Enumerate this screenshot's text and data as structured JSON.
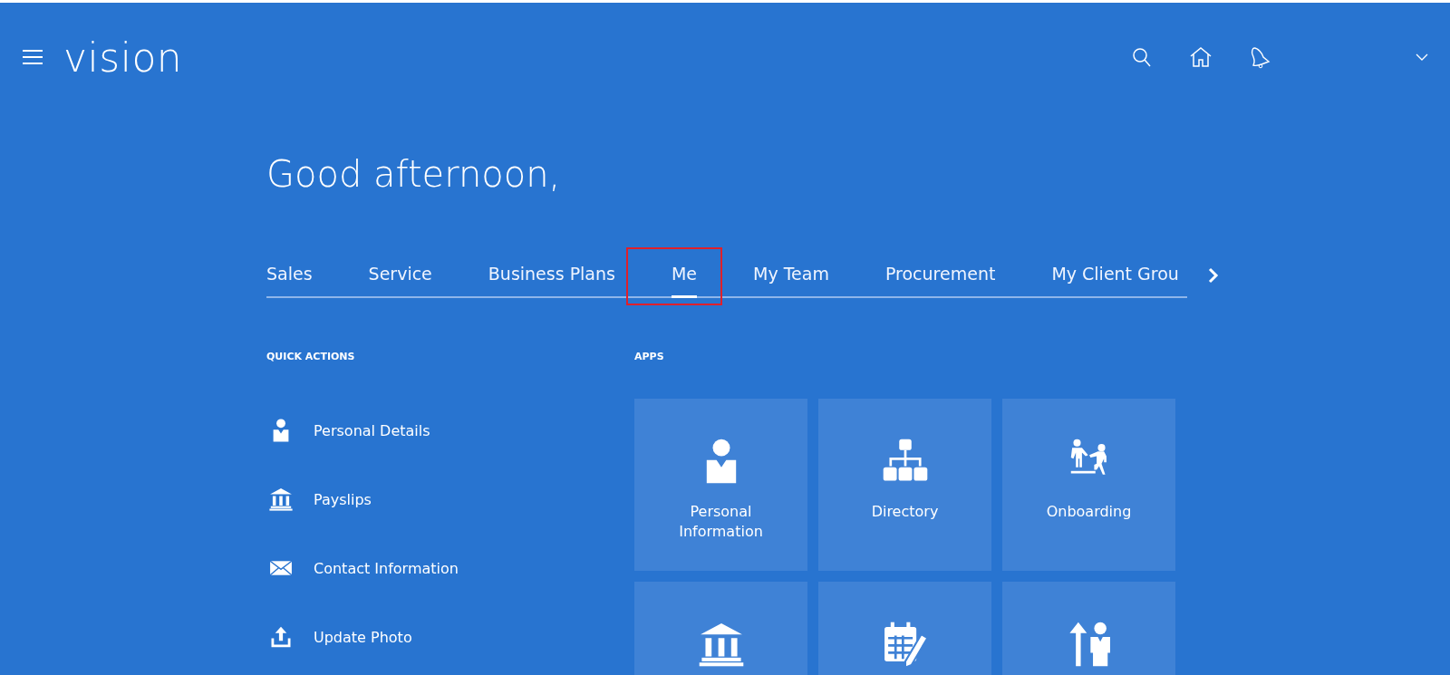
{
  "header": {
    "logo": "vision"
  },
  "greeting": "Good afternoon,",
  "tabs": [
    {
      "label": "Sales",
      "selected": false,
      "highlighted": false
    },
    {
      "label": "Service",
      "selected": false,
      "highlighted": false
    },
    {
      "label": "Business Plans",
      "selected": false,
      "highlighted": false
    },
    {
      "label": "Me",
      "selected": true,
      "highlighted": true
    },
    {
      "label": "My Team",
      "selected": false,
      "highlighted": false
    },
    {
      "label": "Procurement",
      "selected": false,
      "highlighted": false
    },
    {
      "label": "My Client Grou",
      "selected": false,
      "highlighted": false
    }
  ],
  "quick_actions": {
    "heading": "QUICK ACTIONS",
    "items": [
      {
        "label": "Personal Details",
        "kind": "person"
      },
      {
        "label": "Payslips",
        "kind": "bank"
      },
      {
        "label": "Contact Information",
        "kind": "mail"
      },
      {
        "label": "Update Photo",
        "kind": "upload"
      }
    ]
  },
  "apps": {
    "heading": "APPS",
    "tiles": [
      {
        "label": "Personal Information",
        "kind": "person"
      },
      {
        "label": "Directory",
        "kind": "org"
      },
      {
        "label": "Onboarding",
        "kind": "onboard"
      },
      {
        "kind": "bank"
      },
      {
        "kind": "calendar"
      },
      {
        "kind": "promote"
      }
    ]
  }
}
